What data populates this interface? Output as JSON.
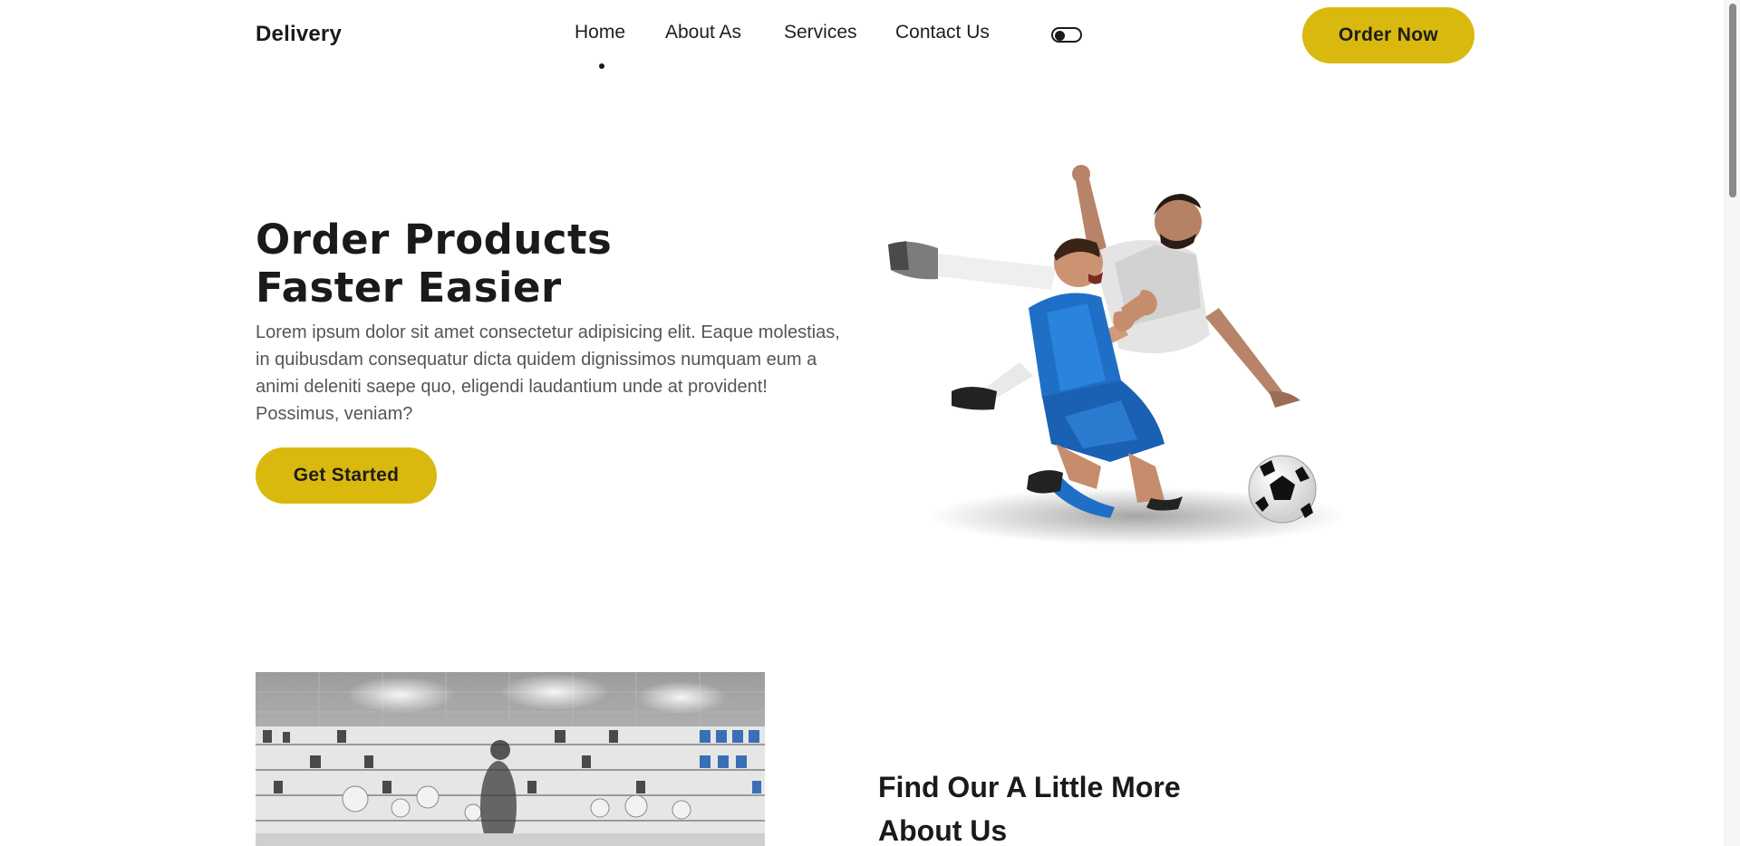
{
  "header": {
    "brand": "Delivery",
    "nav": [
      "Home",
      "About As",
      "Services",
      "Contact Us"
    ],
    "active_nav": "Home",
    "order_button": "Order Now",
    "theme_toggle_icon": "toggle-switch-icon"
  },
  "hero": {
    "title_line1": "Order Products",
    "title_line2": "Faster Easier",
    "text": "Lorem ipsum dolor sit amet consectetur adipisicing elit. Eaque molestias, in quibusdam consequatur dicta quidem dignissimos numquam eum a animi deleniti saepe quo, eligendi laudantium unde at provident! Possimus, veniam?",
    "button": "Get Started",
    "image": "soccer-players-image"
  },
  "about": {
    "title_line1": "Find Our A Little More",
    "title_line2": "About Us",
    "image": "store-interior-image"
  },
  "colors": {
    "accent": "#d9b90d",
    "text": "#1a1a1a",
    "muted": "#555555"
  }
}
